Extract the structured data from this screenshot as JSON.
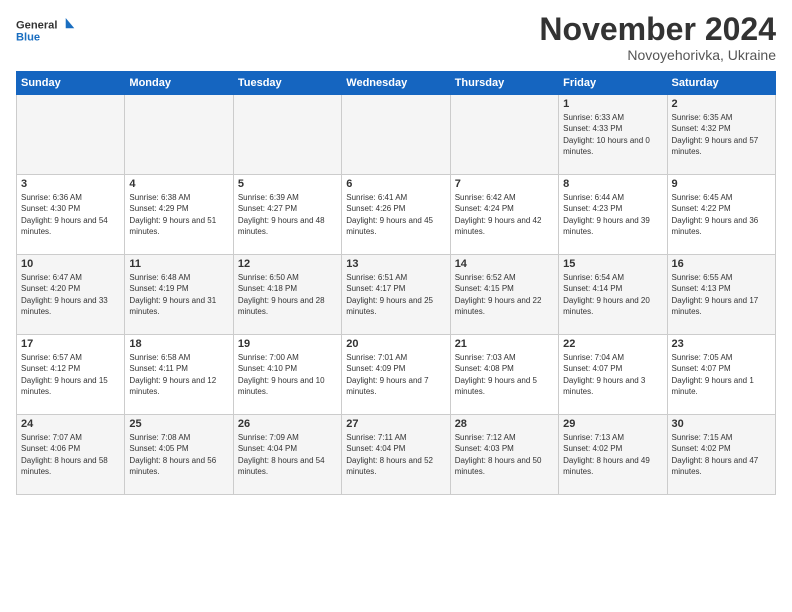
{
  "header": {
    "logo_line1": "General",
    "logo_line2": "Blue",
    "month": "November 2024",
    "location": "Novoyehorivka, Ukraine"
  },
  "days_of_week": [
    "Sunday",
    "Monday",
    "Tuesday",
    "Wednesday",
    "Thursday",
    "Friday",
    "Saturday"
  ],
  "weeks": [
    [
      {
        "day": "",
        "sunrise": "",
        "sunset": "",
        "daylight": ""
      },
      {
        "day": "",
        "sunrise": "",
        "sunset": "",
        "daylight": ""
      },
      {
        "day": "",
        "sunrise": "",
        "sunset": "",
        "daylight": ""
      },
      {
        "day": "",
        "sunrise": "",
        "sunset": "",
        "daylight": ""
      },
      {
        "day": "",
        "sunrise": "",
        "sunset": "",
        "daylight": ""
      },
      {
        "day": "1",
        "sunrise": "Sunrise: 6:33 AM",
        "sunset": "Sunset: 4:33 PM",
        "daylight": "Daylight: 10 hours and 0 minutes."
      },
      {
        "day": "2",
        "sunrise": "Sunrise: 6:35 AM",
        "sunset": "Sunset: 4:32 PM",
        "daylight": "Daylight: 9 hours and 57 minutes."
      }
    ],
    [
      {
        "day": "3",
        "sunrise": "Sunrise: 6:36 AM",
        "sunset": "Sunset: 4:30 PM",
        "daylight": "Daylight: 9 hours and 54 minutes."
      },
      {
        "day": "4",
        "sunrise": "Sunrise: 6:38 AM",
        "sunset": "Sunset: 4:29 PM",
        "daylight": "Daylight: 9 hours and 51 minutes."
      },
      {
        "day": "5",
        "sunrise": "Sunrise: 6:39 AM",
        "sunset": "Sunset: 4:27 PM",
        "daylight": "Daylight: 9 hours and 48 minutes."
      },
      {
        "day": "6",
        "sunrise": "Sunrise: 6:41 AM",
        "sunset": "Sunset: 4:26 PM",
        "daylight": "Daylight: 9 hours and 45 minutes."
      },
      {
        "day": "7",
        "sunrise": "Sunrise: 6:42 AM",
        "sunset": "Sunset: 4:24 PM",
        "daylight": "Daylight: 9 hours and 42 minutes."
      },
      {
        "day": "8",
        "sunrise": "Sunrise: 6:44 AM",
        "sunset": "Sunset: 4:23 PM",
        "daylight": "Daylight: 9 hours and 39 minutes."
      },
      {
        "day": "9",
        "sunrise": "Sunrise: 6:45 AM",
        "sunset": "Sunset: 4:22 PM",
        "daylight": "Daylight: 9 hours and 36 minutes."
      }
    ],
    [
      {
        "day": "10",
        "sunrise": "Sunrise: 6:47 AM",
        "sunset": "Sunset: 4:20 PM",
        "daylight": "Daylight: 9 hours and 33 minutes."
      },
      {
        "day": "11",
        "sunrise": "Sunrise: 6:48 AM",
        "sunset": "Sunset: 4:19 PM",
        "daylight": "Daylight: 9 hours and 31 minutes."
      },
      {
        "day": "12",
        "sunrise": "Sunrise: 6:50 AM",
        "sunset": "Sunset: 4:18 PM",
        "daylight": "Daylight: 9 hours and 28 minutes."
      },
      {
        "day": "13",
        "sunrise": "Sunrise: 6:51 AM",
        "sunset": "Sunset: 4:17 PM",
        "daylight": "Daylight: 9 hours and 25 minutes."
      },
      {
        "day": "14",
        "sunrise": "Sunrise: 6:52 AM",
        "sunset": "Sunset: 4:15 PM",
        "daylight": "Daylight: 9 hours and 22 minutes."
      },
      {
        "day": "15",
        "sunrise": "Sunrise: 6:54 AM",
        "sunset": "Sunset: 4:14 PM",
        "daylight": "Daylight: 9 hours and 20 minutes."
      },
      {
        "day": "16",
        "sunrise": "Sunrise: 6:55 AM",
        "sunset": "Sunset: 4:13 PM",
        "daylight": "Daylight: 9 hours and 17 minutes."
      }
    ],
    [
      {
        "day": "17",
        "sunrise": "Sunrise: 6:57 AM",
        "sunset": "Sunset: 4:12 PM",
        "daylight": "Daylight: 9 hours and 15 minutes."
      },
      {
        "day": "18",
        "sunrise": "Sunrise: 6:58 AM",
        "sunset": "Sunset: 4:11 PM",
        "daylight": "Daylight: 9 hours and 12 minutes."
      },
      {
        "day": "19",
        "sunrise": "Sunrise: 7:00 AM",
        "sunset": "Sunset: 4:10 PM",
        "daylight": "Daylight: 9 hours and 10 minutes."
      },
      {
        "day": "20",
        "sunrise": "Sunrise: 7:01 AM",
        "sunset": "Sunset: 4:09 PM",
        "daylight": "Daylight: 9 hours and 7 minutes."
      },
      {
        "day": "21",
        "sunrise": "Sunrise: 7:03 AM",
        "sunset": "Sunset: 4:08 PM",
        "daylight": "Daylight: 9 hours and 5 minutes."
      },
      {
        "day": "22",
        "sunrise": "Sunrise: 7:04 AM",
        "sunset": "Sunset: 4:07 PM",
        "daylight": "Daylight: 9 hours and 3 minutes."
      },
      {
        "day": "23",
        "sunrise": "Sunrise: 7:05 AM",
        "sunset": "Sunset: 4:07 PM",
        "daylight": "Daylight: 9 hours and 1 minute."
      }
    ],
    [
      {
        "day": "24",
        "sunrise": "Sunrise: 7:07 AM",
        "sunset": "Sunset: 4:06 PM",
        "daylight": "Daylight: 8 hours and 58 minutes."
      },
      {
        "day": "25",
        "sunrise": "Sunrise: 7:08 AM",
        "sunset": "Sunset: 4:05 PM",
        "daylight": "Daylight: 8 hours and 56 minutes."
      },
      {
        "day": "26",
        "sunrise": "Sunrise: 7:09 AM",
        "sunset": "Sunset: 4:04 PM",
        "daylight": "Daylight: 8 hours and 54 minutes."
      },
      {
        "day": "27",
        "sunrise": "Sunrise: 7:11 AM",
        "sunset": "Sunset: 4:04 PM",
        "daylight": "Daylight: 8 hours and 52 minutes."
      },
      {
        "day": "28",
        "sunrise": "Sunrise: 7:12 AM",
        "sunset": "Sunset: 4:03 PM",
        "daylight": "Daylight: 8 hours and 50 minutes."
      },
      {
        "day": "29",
        "sunrise": "Sunrise: 7:13 AM",
        "sunset": "Sunset: 4:02 PM",
        "daylight": "Daylight: 8 hours and 49 minutes."
      },
      {
        "day": "30",
        "sunrise": "Sunrise: 7:15 AM",
        "sunset": "Sunset: 4:02 PM",
        "daylight": "Daylight: 8 hours and 47 minutes."
      }
    ]
  ]
}
